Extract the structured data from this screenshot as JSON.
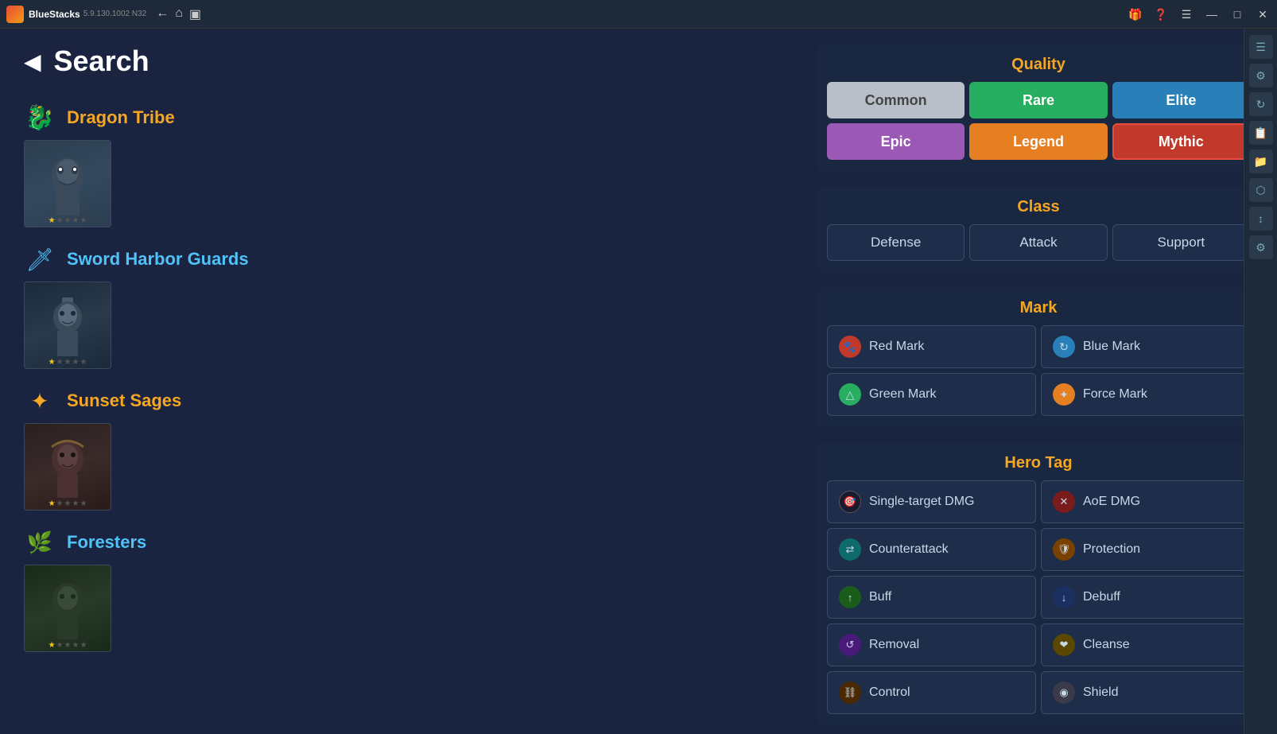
{
  "titlebar": {
    "appname": "BlueStacks",
    "version": "5.9.130.1002  N32",
    "nav": [
      "←",
      "⌂",
      "▣"
    ]
  },
  "page": {
    "title": "Search",
    "back_label": "◀"
  },
  "factions": [
    {
      "name": "Dragon Tribe",
      "color": "gold",
      "icon_type": "dragon",
      "heroes": [
        {
          "stars": 1,
          "total_stars": 5,
          "bg": "dragon-hero-bg"
        }
      ]
    },
    {
      "name": "Sword Harbor Guards",
      "color": "teal",
      "icon_type": "sword",
      "heroes": [
        {
          "stars": 1,
          "total_stars": 5,
          "bg": "sword-hero-bg"
        }
      ]
    },
    {
      "name": "Sunset Sages",
      "color": "gold",
      "icon_type": "sunset",
      "heroes": [
        {
          "stars": 1,
          "total_stars": 5,
          "bg": "sunset-hero-bg"
        }
      ]
    },
    {
      "name": "Foresters",
      "color": "teal",
      "icon_type": "forester",
      "heroes": [
        {
          "stars": 1,
          "total_stars": 5,
          "bg": "forester-hero-bg"
        }
      ]
    }
  ],
  "quality": {
    "title": "Quality",
    "buttons": [
      {
        "label": "Common",
        "class": "common"
      },
      {
        "label": "Rare",
        "class": "rare"
      },
      {
        "label": "Elite",
        "class": "elite"
      },
      {
        "label": "Epic",
        "class": "epic"
      },
      {
        "label": "Legend",
        "class": "legend"
      },
      {
        "label": "Mythic",
        "class": "mythic"
      }
    ]
  },
  "class_section": {
    "title": "Class",
    "buttons": [
      {
        "label": "Defense"
      },
      {
        "label": "Attack"
      },
      {
        "label": "Support"
      }
    ]
  },
  "mark": {
    "title": "Mark",
    "buttons": [
      {
        "label": "Red Mark",
        "icon": "red",
        "symbol": "🐾"
      },
      {
        "label": "Blue Mark",
        "icon": "blue",
        "symbol": "↻"
      },
      {
        "label": "Green Mark",
        "icon": "green",
        "symbol": "△"
      },
      {
        "label": "Force Mark",
        "icon": "gold",
        "symbol": "✦"
      }
    ]
  },
  "hero_tag": {
    "title": "Hero Tag",
    "buttons": [
      {
        "label": "Single-target DMG",
        "icon": "dark",
        "symbol": "🎯"
      },
      {
        "label": "AoE DMG",
        "icon": "red",
        "symbol": "✕"
      },
      {
        "label": "Counterattack",
        "icon": "teal",
        "symbol": "⇄"
      },
      {
        "label": "Protection",
        "icon": "orange",
        "symbol": "🛡"
      },
      {
        "label": "Buff",
        "icon": "green",
        "symbol": "↑"
      },
      {
        "label": "Debuff",
        "icon": "blue",
        "symbol": "↓"
      },
      {
        "label": "Removal",
        "icon": "purple",
        "symbol": "↺"
      },
      {
        "label": "Cleanse",
        "icon": "yellow",
        "symbol": "❤"
      },
      {
        "label": "Control",
        "icon": "brown",
        "symbol": "⛓"
      },
      {
        "label": "Shield",
        "icon": "gray",
        "symbol": "◉"
      }
    ]
  },
  "right_strip": {
    "icons": [
      "☰",
      "⚙",
      "↻",
      "📋",
      "📁",
      "⬡",
      "↕",
      "⚙"
    ]
  }
}
